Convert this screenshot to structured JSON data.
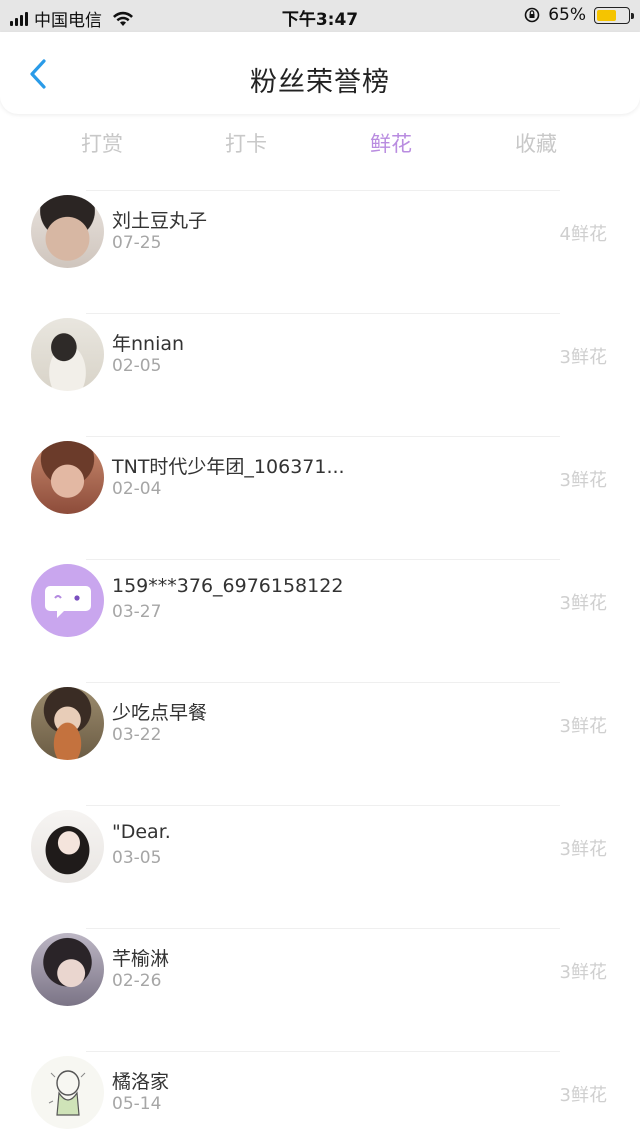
{
  "status_bar": {
    "carrier": "中国电信",
    "time": "下午3:47",
    "battery_percent": "65%",
    "battery_level": 0.65,
    "signal_icon": "signal-icon",
    "wifi_icon": "wifi-icon",
    "rotation_lock_icon": "rotation-lock-icon",
    "battery_color": "#f5c400"
  },
  "nav": {
    "title": "粉丝荣誉榜",
    "back_icon": "chevron-left-icon",
    "back_color": "#2a9be8"
  },
  "tabs": [
    {
      "label": "打赏",
      "active": false
    },
    {
      "label": "打卡",
      "active": false
    },
    {
      "label": "鲜花",
      "active": true
    },
    {
      "label": "收藏",
      "active": false
    }
  ],
  "accent_color": "#b98ce0",
  "fans": [
    {
      "name": "刘土豆丸子",
      "date": "07-25",
      "count": "4鲜花"
    },
    {
      "name": "年nnian",
      "date": "02-05",
      "count": "3鲜花"
    },
    {
      "name": "TNT时代少年团_106371...",
      "date": "02-04",
      "count": "3鲜花"
    },
    {
      "name": "159***376_6976158122",
      "date": "03-27",
      "count": "3鲜花"
    },
    {
      "name": "少吃点早餐",
      "date": "03-22",
      "count": "3鲜花"
    },
    {
      "name": "\"Dear.",
      "date": "03-05",
      "count": "3鲜花"
    },
    {
      "name": "芊榆淋",
      "date": "02-26",
      "count": "3鲜花"
    },
    {
      "name": "橘洛家",
      "date": "05-14",
      "count": "3鲜花"
    }
  ]
}
